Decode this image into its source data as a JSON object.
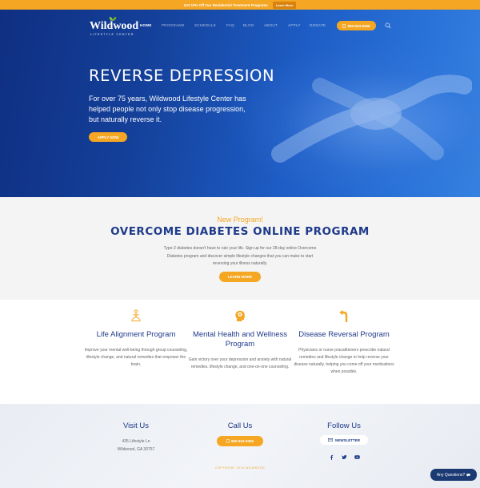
{
  "promo": {
    "text": "Get 10% Off Our Residential Treatment Programs",
    "button": "Learn More"
  },
  "brand": {
    "name": "Wildwood",
    "tagline": "LIFESTYLE CENTER"
  },
  "nav": {
    "items": [
      {
        "label": "HOME",
        "active": true
      },
      {
        "label": "PROGRAMS",
        "active": false
      },
      {
        "label": "SCHEDULE",
        "active": false
      },
      {
        "label": "FAQ",
        "active": false
      },
      {
        "label": "BLOG",
        "active": false
      },
      {
        "label": "ABOUT",
        "active": false
      },
      {
        "label": "APPLY",
        "active": false
      },
      {
        "label": "DONATE",
        "active": false
      }
    ],
    "phone": "800-634-9355",
    "search_icon": "search-icon"
  },
  "hero": {
    "title": "REVERSE DEPRESSION",
    "text": "For over 75 years, Wildwood Lifestyle Center has helped people not only stop disease progression, but naturally reverse it.",
    "button": "APPLY NOW"
  },
  "new_program": {
    "label": "New Program!",
    "title": "OVERCOME DIABETES ONLINE PROGRAM",
    "text": "Type-2 diabetes doesn't have to rule your life. Sign up for our 28-day online Overcome Diabetes program and discover simple lifestyle changes that you can make to start reversing your illness naturally.",
    "button": "LEARN MORE"
  },
  "features": [
    {
      "icon": "meditation-icon",
      "title": "Life Alignment Program",
      "text": "Improve your mental well-being through group counseling, lifestyle change, and natural remedies that empower the brain."
    },
    {
      "icon": "brain-head-icon",
      "title": "Mental Health and Wellness Program",
      "text": "Gain victory over your depression and anxiety with natural remedies, lifestyle change, and one-on-one counseling."
    },
    {
      "icon": "u-turn-arrow-icon",
      "title": "Disease Reversal Program",
      "text": "Physicians or nurse pracatitioners prescribe natural remedies and lifestyle change to help reverse your disease naturally, helping you come off your medications when possible."
    }
  ],
  "footer": {
    "visit": {
      "title": "Visit Us",
      "line1": "435 Lifestyle Ln",
      "line2": "Wildwood, GA 30757"
    },
    "call": {
      "title": "Call Us",
      "phone": "800-634-9355"
    },
    "follow": {
      "title": "Follow Us",
      "newsletter": "NEWSLETTER",
      "socials": [
        "facebook-icon",
        "twitter-icon",
        "youtube-icon"
      ]
    },
    "copyright": "COPYRIGHT 2019 WILDWOOD"
  },
  "chat": {
    "label": "Any Questions?"
  },
  "colors": {
    "accent": "#f5a623",
    "brand_blue": "#1e3a8a",
    "hero_blue": "#1d5cc4"
  }
}
